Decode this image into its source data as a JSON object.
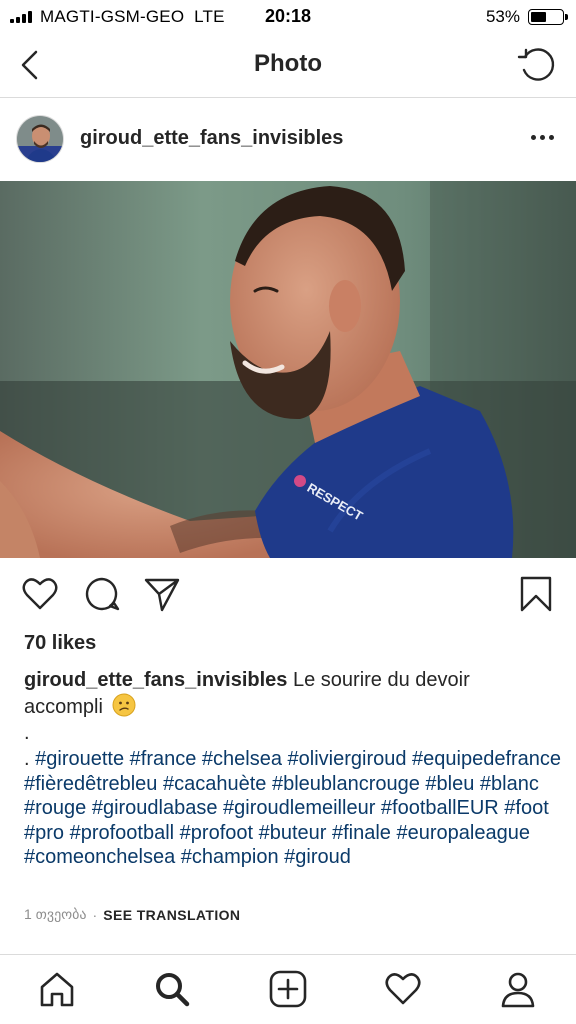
{
  "status_bar": {
    "carrier": "MAGTI-GSM-GEO",
    "network": "LTE",
    "time": "20:18",
    "battery_percent_text": "53%",
    "battery_level": 0.53
  },
  "nav": {
    "title": "Photo"
  },
  "post": {
    "username": "giroud_ette_fans_invisibles",
    "likes": "70 likes",
    "caption_username": "giroud_ette_fans_invisibles",
    "caption_text": "Le sourire du devoir accompli",
    "caption_emoji": "confused-face-emoji",
    "dot_line": ".",
    "hashtag_lead": ". ",
    "hashtags": "#girouette #france #chelsea #oliviergiroud #equipedefrance  #fièredêtrebleu #cacahuète #bleublancrouge #bleu #blanc #rouge #giroudlabase #giroudlemeilleur #footballEUR #foot #pro #profootball #profoot  #buteur #finale #europaleague #comeonchelsea #champion #giroud",
    "timestamp": "1 თვეობა",
    "see_translation": "SEE TRANSLATION",
    "photo_badge_text": "RESPECT"
  },
  "colors": {
    "hashtag": "#0b3a69",
    "text": "#262626",
    "muted": "#8e8e8e",
    "divider": "#dbdbdb",
    "jersey": "#1f3a8a"
  },
  "icons": {
    "nav": [
      "back-chevron-icon",
      "refresh-icon"
    ],
    "actions": [
      "heart-icon",
      "comment-icon",
      "share-icon",
      "bookmark-icon"
    ],
    "tabs": [
      "home-icon",
      "search-icon",
      "add-icon",
      "activity-heart-icon",
      "profile-icon"
    ]
  }
}
